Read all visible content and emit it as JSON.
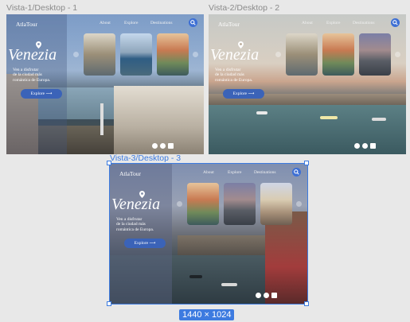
{
  "frames": [
    {
      "label": "Vista-1/Desktop - 1",
      "logo": "AtlaTour",
      "nav": [
        "About",
        "Explore",
        "Destinations"
      ],
      "title": "Venezia",
      "subtitle": [
        "Ven a disfrutar",
        "de la ciudad más",
        "romántica de Europa."
      ],
      "cta": "Explore"
    },
    {
      "label": "Vista-2/Desktop - 2",
      "logo": "AtlaTour",
      "nav": [
        "About",
        "Explore",
        "Destinations"
      ],
      "title": "Venezia",
      "subtitle": [
        "Ven a disfrutar",
        "de la ciudad más",
        "romántica de Europa."
      ],
      "cta": "Explore"
    },
    {
      "label": "Vista-3/Desktop - 3",
      "logo": "AtlaTour",
      "nav": [
        "About",
        "Explore",
        "Destinations"
      ],
      "title": "Venezia",
      "subtitle": [
        "Ven a disfrutar",
        "de la ciudad más",
        "romántica de Europa."
      ],
      "cta": "Explore"
    }
  ],
  "selection": {
    "dimensions": "1440 × 1024"
  },
  "icons": {
    "search": "search-icon",
    "pin": "location-pin-icon",
    "arrow_right": "arrow-right-icon",
    "facebook": "facebook-icon",
    "instagram": "instagram-icon",
    "twitter": "twitter-icon"
  },
  "colors": {
    "accent": "#3d7be0",
    "cta": "#3b63b8",
    "search_button": "#3d6fd4",
    "canvas": "#e8e8e8"
  }
}
